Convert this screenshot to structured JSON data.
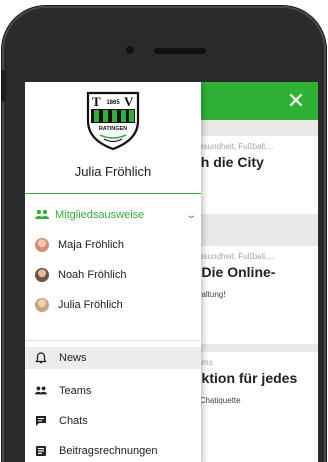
{
  "background": {
    "cards": [
      {
        "meta": "Gesundheit, Fußball,...",
        "title": "ch die City",
        "excerpt": ""
      },
      {
        "meta": "Gesundheit, Fußball,...",
        "title": ": Die Online-",
        "excerpt": "rwaltung!"
      },
      {
        "meta": "eams",
        "title": "nktion für jedes",
        "excerpt": "e Chatiquette"
      }
    ]
  },
  "drawer": {
    "logo": {
      "year": "1865",
      "left_letter": "T",
      "right_letter": "V",
      "city": "RATINGEN"
    },
    "user_name": "Julia Fröhlich",
    "section": {
      "label": "Mitgliedsausweise",
      "icon": "people-icon"
    },
    "members": [
      {
        "name": "Maja Fröhlich",
        "avatar_color": "#d98b6e"
      },
      {
        "name": "Noah Fröhlich",
        "avatar_color": "#8a6d5c"
      },
      {
        "name": "Julia Fröhlich",
        "avatar_color": "#c9a47e"
      }
    ],
    "nav": [
      {
        "label": "News",
        "icon": "bell-icon",
        "active": true
      },
      {
        "label": "Teams",
        "icon": "people-icon",
        "active": false
      },
      {
        "label": "Chats",
        "icon": "chat-icon",
        "active": false
      },
      {
        "label": "Beitragsrechnungen",
        "icon": "invoice-icon",
        "active": false
      }
    ]
  },
  "colors": {
    "accent": "#2eb135",
    "text": "#222222",
    "active_bg": "#ececec"
  }
}
